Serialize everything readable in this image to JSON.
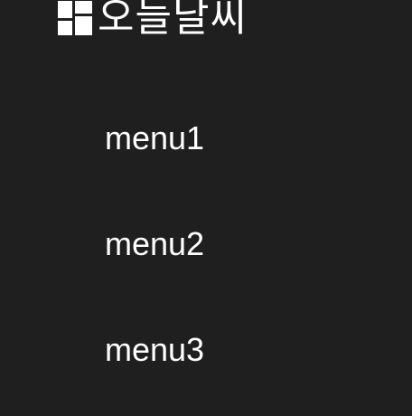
{
  "brand": {
    "icon": "dashboard-grid-icon",
    "title": "오늘날씨"
  },
  "menu": {
    "items": [
      {
        "label": "menu1"
      },
      {
        "label": "menu2"
      },
      {
        "label": "menu3"
      }
    ]
  },
  "colors": {
    "background": "#1f1f1f",
    "text": "#ffffff"
  }
}
